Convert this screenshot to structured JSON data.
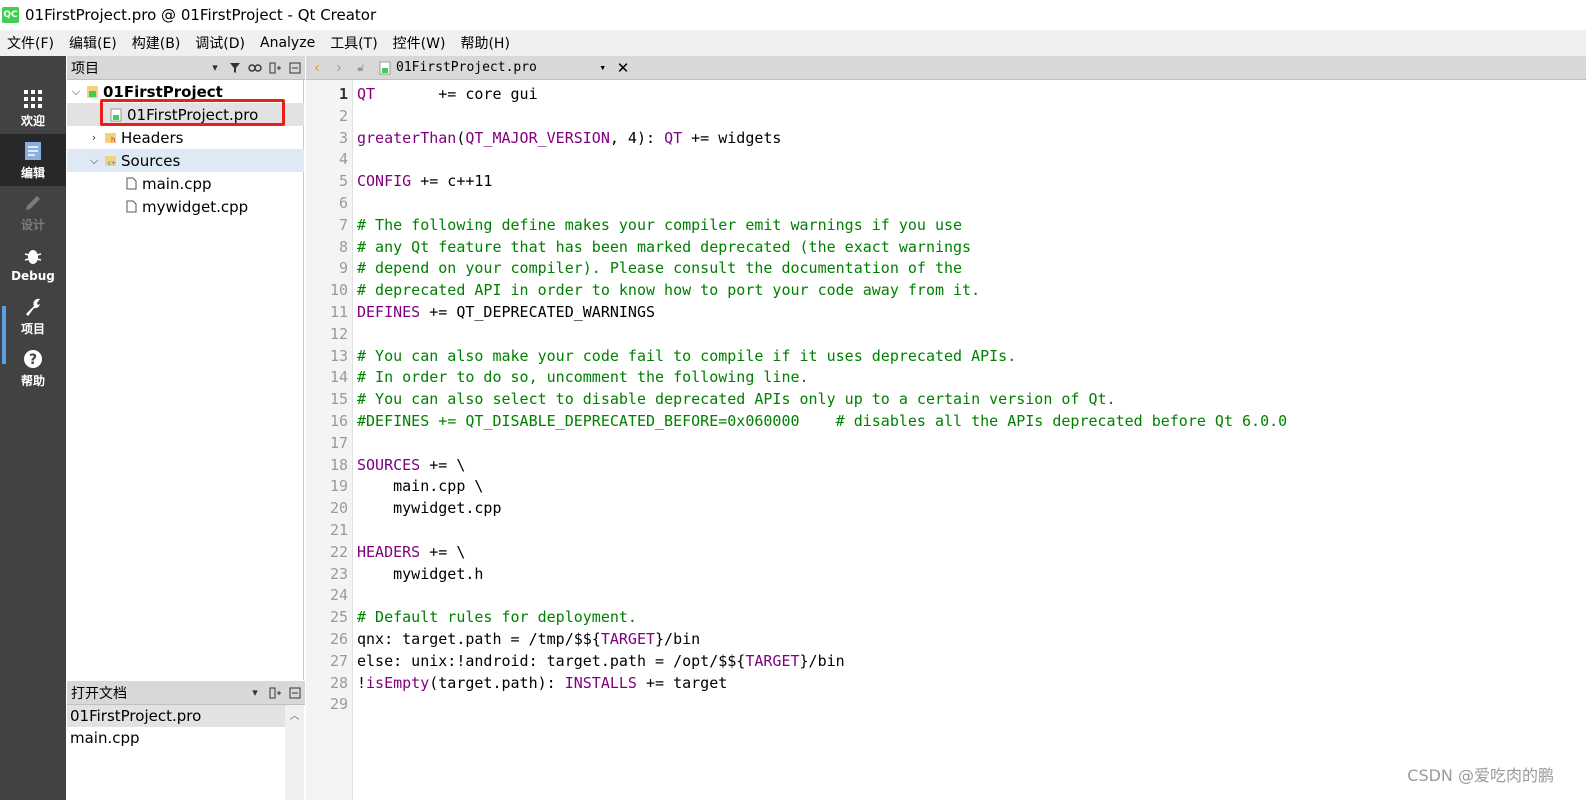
{
  "window": {
    "title": "01FirstProject.pro @ 01FirstProject - Qt Creator",
    "logo": "QC"
  },
  "menu": [
    "文件(F)",
    "编辑(E)",
    "构建(B)",
    "调试(D)",
    "Analyze",
    "工具(T)",
    "控件(W)",
    "帮助(H)"
  ],
  "modes": [
    {
      "label": "欢迎",
      "icon": "grid-icon"
    },
    {
      "label": "编辑",
      "icon": "document-icon"
    },
    {
      "label": "设计",
      "icon": "pencil-icon"
    },
    {
      "label": "Debug",
      "icon": "bug-icon"
    },
    {
      "label": "项目",
      "icon": "wrench-icon"
    },
    {
      "label": "帮助",
      "icon": "question-icon"
    }
  ],
  "project_panel": {
    "title": "项目",
    "tree": {
      "root": "01FirstProject",
      "pro_file": "01FirstProject.pro",
      "headers": "Headers",
      "sources": "Sources",
      "source_files": [
        "main.cpp",
        "mywidget.cpp"
      ]
    }
  },
  "open_docs": {
    "title": "打开文档",
    "items": [
      "01FirstProject.pro",
      "main.cpp"
    ]
  },
  "editor": {
    "current_file": "01FirstProject.pro",
    "lines": [
      [
        [
          "QT",
          "kw"
        ],
        [
          "       += core gui",
          ""
        ]
      ],
      [],
      [
        [
          "greaterThan",
          "kw"
        ],
        [
          "(",
          ""
        ],
        [
          "QT_MAJOR_VERSION",
          "kw"
        ],
        [
          ", 4): ",
          ""
        ],
        [
          "QT",
          "kw"
        ],
        [
          " += widgets",
          ""
        ]
      ],
      [],
      [
        [
          "CONFIG",
          "kw"
        ],
        [
          " += c++11",
          ""
        ]
      ],
      [],
      [
        [
          "# The following define makes your compiler emit warnings if you use",
          "cm"
        ]
      ],
      [
        [
          "# any Qt feature that has been marked deprecated (the exact warnings",
          "cm"
        ]
      ],
      [
        [
          "# depend on your compiler). Please consult the documentation of the",
          "cm"
        ]
      ],
      [
        [
          "# deprecated API in order to know how to port your code away from it.",
          "cm"
        ]
      ],
      [
        [
          "DEFINES",
          "kw"
        ],
        [
          " += QT_DEPRECATED_WARNINGS",
          ""
        ]
      ],
      [],
      [
        [
          "# You can also make your code fail to compile if it uses deprecated APIs.",
          "cm"
        ]
      ],
      [
        [
          "# In order to do so, uncomment the following line.",
          "cm"
        ]
      ],
      [
        [
          "# You can also select to disable deprecated APIs only up to a certain version of Qt.",
          "cm"
        ]
      ],
      [
        [
          "#DEFINES += QT_DISABLE_DEPRECATED_BEFORE=0x060000    # disables all the APIs deprecated before Qt 6.0.0",
          "cm"
        ]
      ],
      [],
      [
        [
          "SOURCES",
          "kw"
        ],
        [
          " += \\",
          ""
        ]
      ],
      [
        [
          "    main.cpp \\",
          ""
        ]
      ],
      [
        [
          "    mywidget.cpp",
          ""
        ]
      ],
      [],
      [
        [
          "HEADERS",
          "kw"
        ],
        [
          " += \\",
          ""
        ]
      ],
      [
        [
          "    mywidget.h",
          ""
        ]
      ],
      [],
      [
        [
          "# Default rules for deployment.",
          "cm"
        ]
      ],
      [
        [
          "qnx: target.path = /tmp/$${",
          ""
        ],
        [
          "TARGET",
          "kw"
        ],
        [
          "}/bin",
          ""
        ]
      ],
      [
        [
          "else: unix:!android: target.path = /opt/$${",
          ""
        ],
        [
          "TARGET",
          "kw"
        ],
        [
          "}/bin",
          ""
        ]
      ],
      [
        [
          "!",
          ""
        ],
        [
          "isEmpty",
          "kw"
        ],
        [
          "(target.path): ",
          ""
        ],
        [
          "INSTALLS",
          "kw"
        ],
        [
          " += target",
          ""
        ]
      ],
      []
    ]
  },
  "watermark": "CSDN @爱吃肉的鹏"
}
